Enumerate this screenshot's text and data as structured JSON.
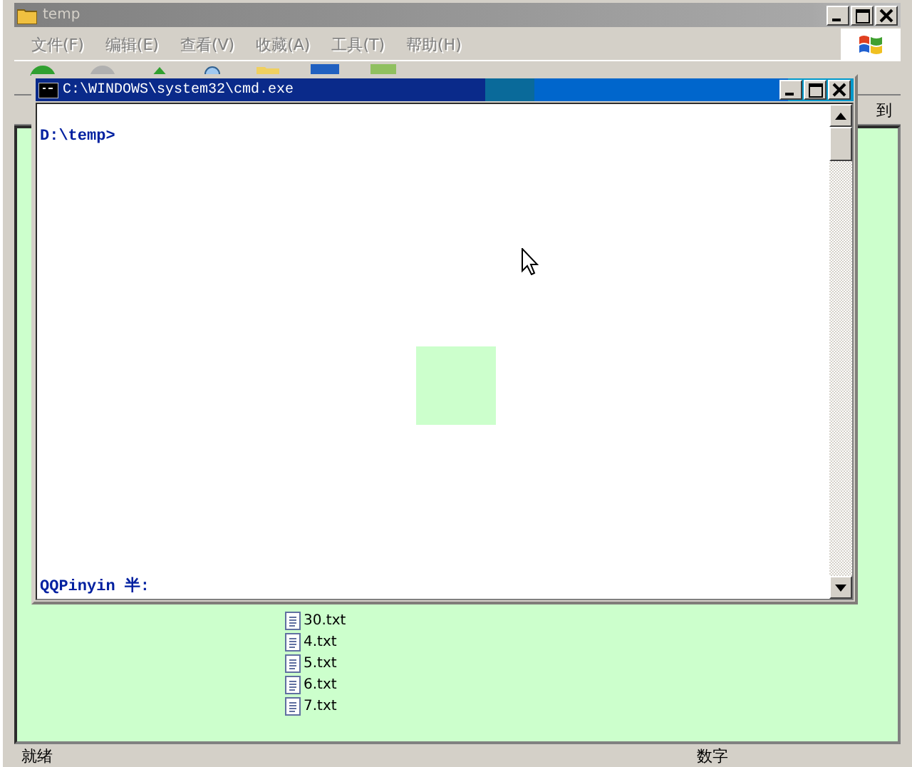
{
  "explorer": {
    "title": "temp",
    "menu": [
      {
        "label": "文件(F)"
      },
      {
        "label": "编辑(E)"
      },
      {
        "label": "查看(V)"
      },
      {
        "label": "收藏(A)"
      },
      {
        "label": "工具(T)"
      },
      {
        "label": "帮助(H)"
      }
    ],
    "address_go": "到",
    "files": [
      {
        "name": "30.txt"
      },
      {
        "name": "4.txt"
      },
      {
        "name": "5.txt"
      },
      {
        "name": "6.txt"
      },
      {
        "name": "7.txt"
      }
    ],
    "status_bar": [
      "就绪",
      "数字"
    ]
  },
  "console": {
    "title": "C:\\WINDOWS\\system32\\cmd.exe",
    "lines": [
      "D:\\temp>"
    ],
    "ime_status": "QQPinyin 半:"
  }
}
